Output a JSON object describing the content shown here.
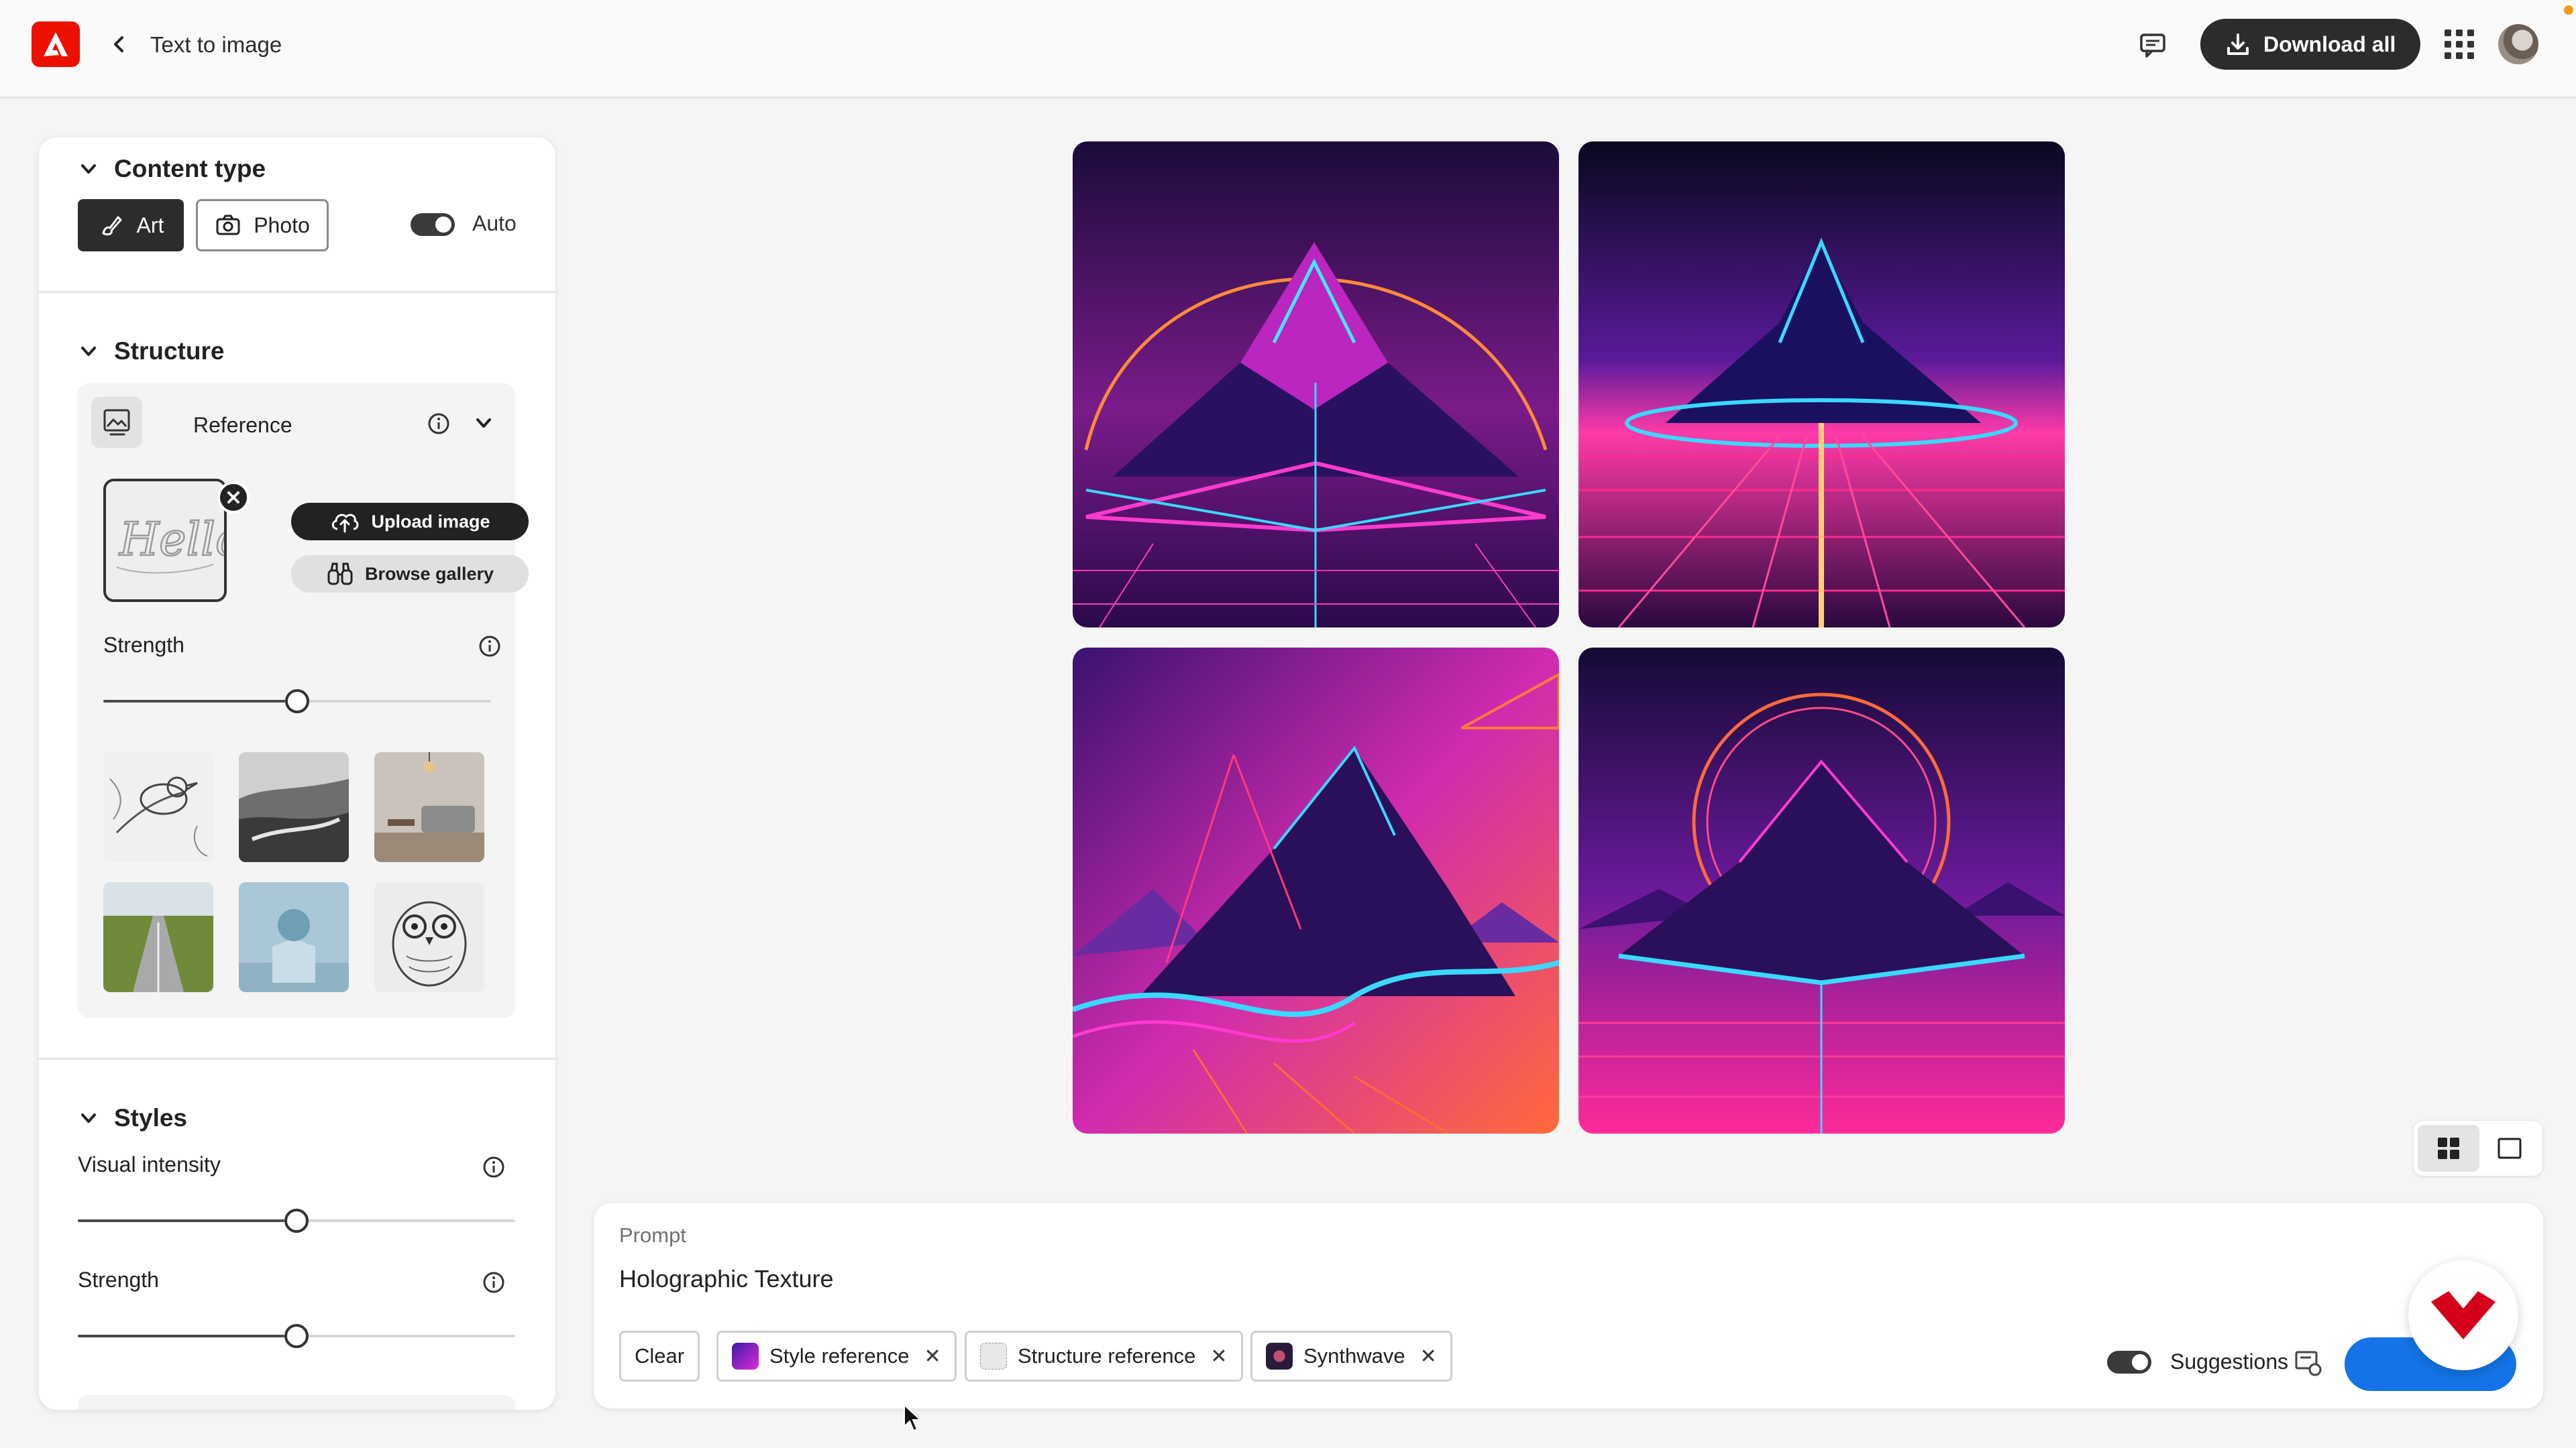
{
  "header": {
    "app_logo": "adobe-logo",
    "page_title": "Text to image",
    "download_label": "Download all"
  },
  "panel": {
    "content_type": {
      "title": "Content type",
      "art_label": "Art",
      "photo_label": "Photo",
      "auto_label": "Auto",
      "selected": "Art",
      "auto_enabled": true
    },
    "structure": {
      "title": "Structure",
      "reference_label": "Reference",
      "upload_label": "Upload image",
      "browse_label": "Browse gallery",
      "strength_label": "Strength",
      "strength_value": 0.5,
      "gallery": [
        "bird-sketch",
        "misty-hills",
        "living-room",
        "road-field",
        "sphere-on-cube",
        "owl-sketch"
      ]
    },
    "styles": {
      "title": "Styles",
      "visual_intensity_label": "Visual intensity",
      "visual_intensity_value": 0.5,
      "strength_label": "Strength",
      "strength_value": 0.5
    }
  },
  "prompt": {
    "label": "Prompt",
    "text": "Holographic Texture",
    "clear_label": "Clear",
    "chips": [
      {
        "label": "Style reference",
        "swatch": "#7b2ff7"
      },
      {
        "label": "Structure reference",
        "swatch": "#cfcfcf"
      },
      {
        "label": "Synthwave",
        "swatch": "#3a1f4a"
      }
    ],
    "suggestions_label": "Suggestions",
    "suggestions_enabled": true
  },
  "colors": {
    "accent": "#1473e6",
    "brand": "#eb1000",
    "dark_button": "#2c2c2c"
  }
}
